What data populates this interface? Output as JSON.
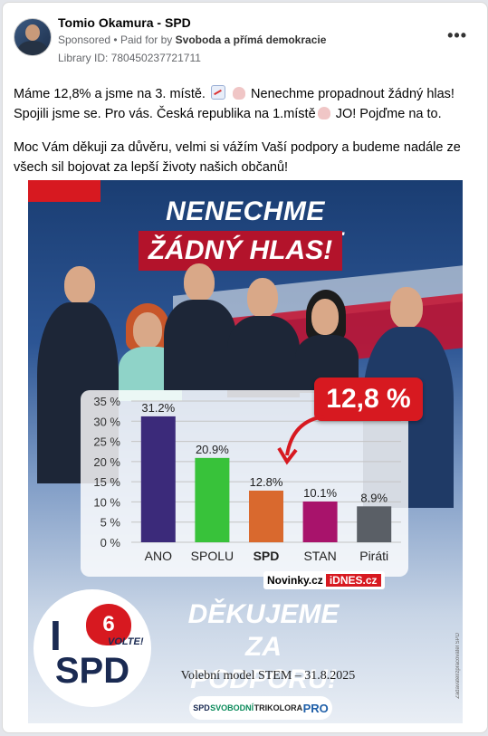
{
  "post": {
    "page_name": "Tomio Okamura - SPD",
    "sponsored": "Sponsored",
    "paid_for_prefix": "Paid for by",
    "paid_for_by": "Svoboda a přímá demokracie",
    "library_id": "Library ID: 780450237721711",
    "more_label": "•••",
    "text_line1a": "Máme 12,8% a jsme na 3. místě.",
    "text_line1b": "Nenechme propadnout žádný hlas! Spojili jsme se. Pro vás. Česká republika na 1.místě",
    "text_line1c": "JO! Pojďme na to.",
    "text_paragraph2": "Moc Vám děkuji za důvěru, velmi si vážím Vaší podpory a budeme nadále ze všech sil bojovat za lepší životy našich občanů!"
  },
  "poster": {
    "headline1": "NENECHME PROPADNOUT",
    "headline2": "ŽÁDNÝ HLAS!",
    "badge": "12,8 %",
    "source_novinky": "Novinky.cz",
    "source_idnes": "iDNES.cz",
    "logo_i": "I",
    "logo_number": "6",
    "logo_volte": "VOLTE!",
    "logo_spd": "SPD",
    "thanks_line1": "DĚKUJEME ZA",
    "thanks_line2": "PODPORU!",
    "model_caption": "Volební model STEM  – 31.8.2025",
    "partner_logos": [
      "SPD",
      "SVOBODNÍ",
      "TRIKOLORA",
      "PRO"
    ],
    "side_note": "Zadavatel/zpracovatel SPD"
  },
  "chart_data": {
    "type": "bar",
    "categories": [
      "ANO",
      "SPOLU",
      "SPD",
      "STAN",
      "Piráti"
    ],
    "values": [
      31.2,
      20.9,
      12.8,
      10.1,
      8.9
    ],
    "value_labels": [
      "31.2%",
      "20.9%",
      "12.8%",
      "10.1%",
      "8.9%"
    ],
    "colors": [
      "#3b2a7a",
      "#38c23a",
      "#d9692e",
      "#a8136b",
      "#5a5f66"
    ],
    "yticks": [
      "35 %",
      "30 %",
      "25 %",
      "20 %",
      "15 %",
      "10 %",
      "5 %",
      "0 %"
    ],
    "ylim": [
      0,
      35
    ],
    "grid": true
  }
}
